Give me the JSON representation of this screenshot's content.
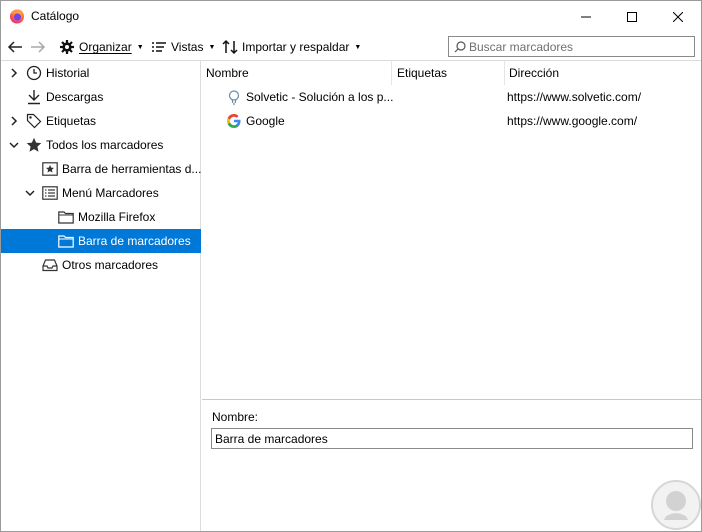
{
  "window": {
    "title": "Catálogo"
  },
  "toolbar": {
    "organize": "Organizar",
    "views": "Vistas",
    "import": "Importar y respaldar",
    "search_placeholder": "Buscar marcadores"
  },
  "sidebar": {
    "items": [
      {
        "label": "Historial",
        "icon": "history-clock-icon",
        "twisty": "collapsed"
      },
      {
        "label": "Descargas",
        "icon": "download-arrow-icon",
        "twisty": "none"
      },
      {
        "label": "Etiquetas",
        "icon": "tag-icon",
        "twisty": "collapsed"
      },
      {
        "label": "Todos los marcadores",
        "icon": "star-icon",
        "twisty": "expanded"
      },
      {
        "label": "Barra de herramientas d...",
        "icon": "bookmarks-toolbar-icon",
        "twisty": "none"
      },
      {
        "label": "Menú Marcadores",
        "icon": "bookmarks-menu-icon",
        "twisty": "expanded"
      },
      {
        "label": "Mozilla Firefox",
        "icon": "folder-icon",
        "twisty": "none"
      },
      {
        "label": "Barra de marcadores",
        "icon": "folder-icon",
        "twisty": "none",
        "selected": true
      },
      {
        "label": "Otros marcadores",
        "icon": "other-bookmarks-tray-icon",
        "twisty": "none"
      }
    ]
  },
  "table": {
    "columns": [
      "Nombre",
      "Etiquetas",
      "Dirección"
    ],
    "rows": [
      {
        "name": "Solvetic - Solución a los p...",
        "tags": "",
        "url": "https://www.solvetic.com/",
        "icon": "solvetic-favicon-icon"
      },
      {
        "name": "Google",
        "tags": "",
        "url": "https://www.google.com/",
        "icon": "google-favicon-icon"
      }
    ]
  },
  "details": {
    "name_label": "Nombre:",
    "name_value": "Barra de marcadores"
  },
  "colors": {
    "selection": "#0078d7"
  }
}
